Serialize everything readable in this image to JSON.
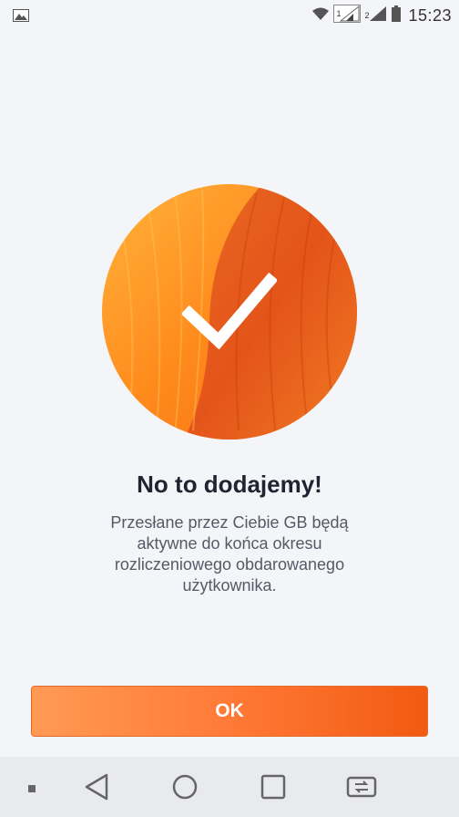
{
  "status_bar": {
    "time": "15:23",
    "sim1_label": "1",
    "sim2_label": "2",
    "icons": [
      "image-icon",
      "wifi-icon",
      "signal-sim1-icon",
      "signal-sim2-icon",
      "battery-icon"
    ]
  },
  "hero": {
    "icon": "checkmark-icon",
    "colors": {
      "light": "#ffa02a",
      "dark": "#e8561a"
    }
  },
  "content": {
    "title": "No to dodajemy!",
    "description": "Przesłane przez Ciebie GB będą aktywne do końca okresu rozliczeniowego obdarowanego użytkownika."
  },
  "actions": {
    "ok_label": "OK",
    "ok_color": "#ff7a36"
  },
  "nav_bar": {
    "icons": [
      "menu-dot-icon",
      "back-icon",
      "home-icon",
      "recents-icon",
      "switch-icon"
    ]
  }
}
